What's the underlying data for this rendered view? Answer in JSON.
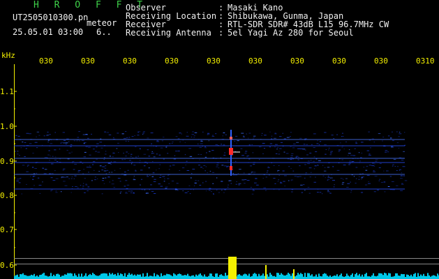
{
  "header": {
    "title": "H R O F F T",
    "filename": "UT2505010300.pn",
    "mode": "meteor",
    "datetime": "25.05.01 03:00",
    "count": "6..",
    "fields": [
      {
        "label": "Observer",
        "value": "Masaki Kano"
      },
      {
        "label": "Receiving Location",
        "value": "Shibukawa, Gunma, Japan"
      },
      {
        "label": "Receiver",
        "value": "RTL-SDR SDR# 43dB L15 96.7MHz CW"
      },
      {
        "label": "Receiving Antenna",
        "value": "5el Yagi Az 280 for Seoul"
      }
    ]
  },
  "axis": {
    "unit": "kHz",
    "y_ticks": [
      "1.1",
      "1.0",
      "0.9",
      "0.8",
      "0.7",
      "0.6"
    ],
    "x_ticks": [
      "030",
      "030",
      "030",
      "030",
      "030",
      "030",
      "030",
      "030",
      "030",
      "0310"
    ]
  },
  "colors": {
    "text_green": "#3fd24a",
    "text_white": "#f2f2f2",
    "axis_yellow": "#f4f000",
    "band_blue": "#2040ff",
    "echo_red": "#ff2a2a",
    "meter_cyan": "#00e0ff"
  }
}
